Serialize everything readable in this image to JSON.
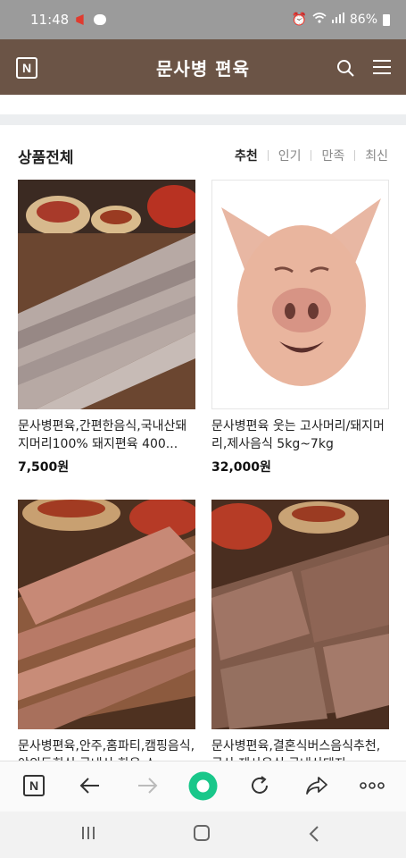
{
  "status_bar": {
    "time": "11:48",
    "battery": "86%"
  },
  "header": {
    "logo": "N",
    "title": "문사병 편육"
  },
  "section": {
    "title": "상품전체",
    "sort_tabs": [
      "추천",
      "인기",
      "만족",
      "최신"
    ],
    "active_sort": "추천"
  },
  "products": [
    {
      "name": "문사병편육,간편한음식,국내산돼지머리100% 돼지편육 400...",
      "price": "7,500원",
      "image": "sliced-pork-head-plate"
    },
    {
      "name": "문사병편육 웃는 고사머리/돼지머리,제사음식 5kg~7kg",
      "price": "32,000원",
      "image": "smiling-pig-head"
    },
    {
      "name": "문사병편육,안주,홈파티,캠핑음식,야외동회식,국내산 한육 소",
      "price": "",
      "image": "sliced-pork-board"
    },
    {
      "name": "문사병편육,결혼식버스음식추천,국산,제사음식,국내산돼지",
      "price": "",
      "image": "pressed-pork-slices"
    }
  ],
  "browser_bar": {
    "logo": "N"
  },
  "colors": {
    "header_bg": "#6b5446",
    "accent_green": "#19c78a"
  }
}
